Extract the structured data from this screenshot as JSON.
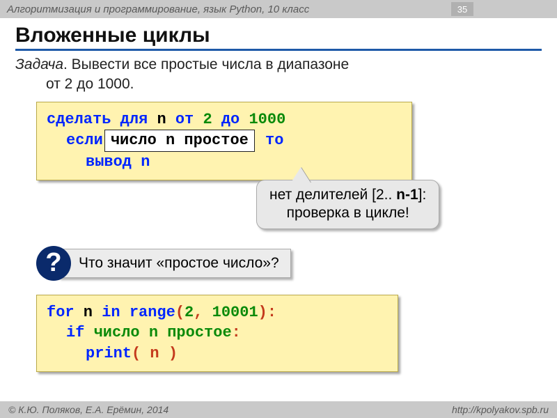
{
  "header": {
    "title": "Алгоритмизация и программирование, язык Python, 10 класс",
    "page_number": "35"
  },
  "slide": {
    "title": "Вложенные циклы",
    "task_label": "Задача",
    "task_text": ". Вывести все простые числа в диапазоне",
    "task_line2": "от 2 до 1000."
  },
  "pseudo": {
    "line1_pre": "сделать для ",
    "n": "n",
    "ot": " от ",
    "two": "2",
    "do": " до ",
    "thousand": "1000",
    "line2_pre": "если",
    "inset": " число n простое ",
    "line2_post": " то",
    "line3": "вывод n"
  },
  "callout": {
    "line1_a": "нет делителей [2.. ",
    "line1_b": "n-1",
    "line1_c": "]:",
    "line2": "проверка в цикле!"
  },
  "question": {
    "mark": "?",
    "text": "Что значит «простое число»?"
  },
  "python": {
    "for": "for",
    "n": " n ",
    "in": "in",
    "range": " range",
    "paren_open": "(",
    "arg1": "2",
    "comma": ", ",
    "arg2": "10001",
    "paren_close": "):",
    "if": "if",
    "cond": " число n простое",
    "colon": ":",
    "print": "print",
    "print_args": "( n )"
  },
  "footer": {
    "left": "© К.Ю. Поляков, Е.А. Ерёмин, 2014",
    "right": "http://kpolyakov.spb.ru"
  }
}
